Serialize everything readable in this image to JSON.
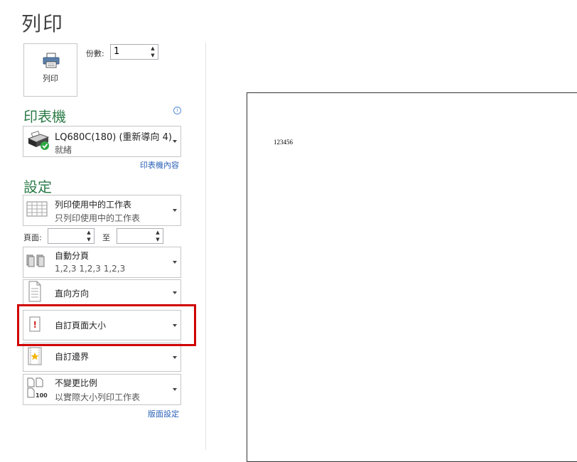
{
  "page": {
    "title": "列印"
  },
  "print_button": {
    "label": "列印"
  },
  "copies": {
    "label": "份數:",
    "value": "1"
  },
  "printer_section": {
    "heading": "印表機",
    "printer_name": "LQ680C(180) (重新導向 4)",
    "printer_status": "就緒",
    "properties_link": "印表機內容"
  },
  "settings_section": {
    "heading": "設定",
    "what_to_print": {
      "title": "列印使用中的工作表",
      "subtitle": "只列印使用中的工作表"
    },
    "pages": {
      "label": "頁面:",
      "from": "",
      "to_label": "至",
      "to": ""
    },
    "collation": {
      "title": "自動分頁",
      "subtitle": "1,2,3    1,2,3    1,2,3"
    },
    "orientation": {
      "title": "直向方向"
    },
    "paper_size": {
      "title": "自訂頁面大小"
    },
    "margins": {
      "title": "自訂邊界"
    },
    "scaling": {
      "title": "不變更比例",
      "subtitle": "以實際大小列印工作表"
    },
    "page_setup_link": "版面設定"
  },
  "preview": {
    "cell_text": "123456"
  },
  "colors": {
    "section_heading": "#2e7d4a",
    "link": "#2a62b8",
    "highlight": "#d00000"
  },
  "icons": [
    "printer-icon",
    "info-icon",
    "printer-device-icon",
    "ready-check-icon",
    "sheet-icon",
    "collate-icon",
    "portrait-page-icon",
    "paper-size-icon",
    "margins-icon",
    "scaling-icon"
  ]
}
